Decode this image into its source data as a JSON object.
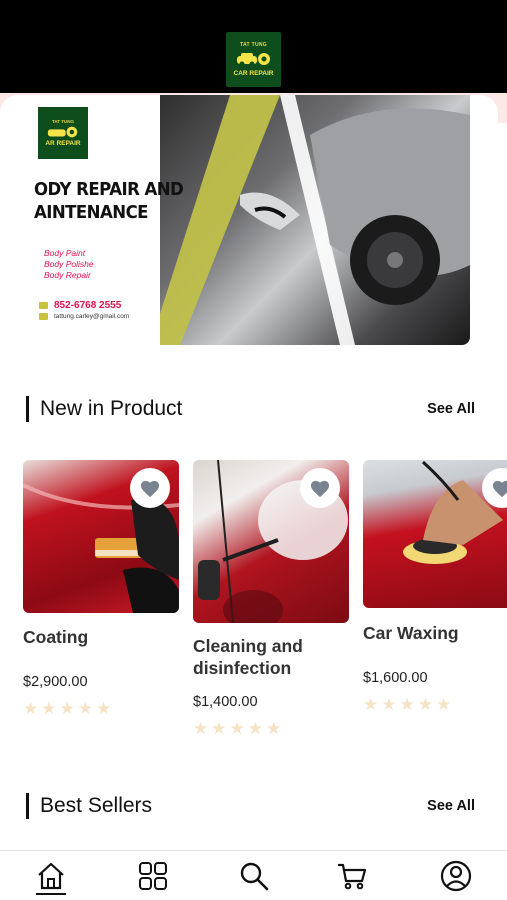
{
  "header": {
    "logo_top": "TAT TUNG",
    "logo_bottom": "CAR REPAIR"
  },
  "banner": {
    "logo_top": "TAT TUNG",
    "logo_bottom": "AR REPAIR",
    "headline_line1": "ODY REPAIR AND",
    "headline_line2": "AINTENANCE",
    "services": [
      "Body Paint",
      "Body Polishe",
      "Body Repair"
    ],
    "phone": "852-6768 2555",
    "email": "tattung.carley@gmail.com"
  },
  "sections": {
    "new_in_product": {
      "title": "New in Product",
      "see_all": "See All"
    },
    "best_sellers": {
      "title": "Best Sellers",
      "see_all": "See All"
    }
  },
  "products": [
    {
      "name": "Coating",
      "price": "$2,900.00",
      "rating": 0,
      "image_icon": "coating-sponge-image"
    },
    {
      "name": "Cleaning and disinfection",
      "price": "$1,400.00",
      "rating": 0,
      "image_icon": "steam-cleaning-image"
    },
    {
      "name": "Car Waxing",
      "price": "$1,600.00",
      "rating": 0,
      "image_icon": "car-waxing-image"
    }
  ],
  "navbar": {
    "items": [
      "home-icon",
      "grid-icon",
      "search-icon",
      "cart-icon",
      "profile-icon"
    ],
    "active": "home-icon"
  },
  "colors": {
    "accent_green": "#0e4d1c",
    "logo_yellow": "#f5e34a",
    "banner_pink": "#e0114f",
    "star_empty": "#f6e3c6",
    "car_red": "#c4111f"
  }
}
